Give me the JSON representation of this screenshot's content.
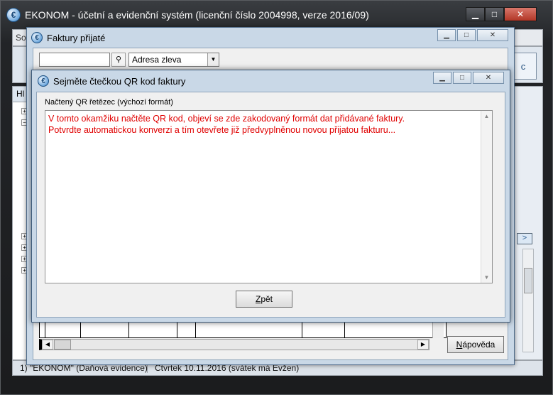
{
  "main_window": {
    "title": "EKONOM - účetní a evidenční systém (licenční číslo 2004998, verze 2016/09)",
    "icon": "ekonom-app-icon",
    "menu_first": "So",
    "tree_header": "Hl",
    "help_glyph": "c",
    "right_button": ">",
    "status": {
      "left": "1) \"EKONOM\" (Daňová evidence)",
      "right": "Čtvrtek 10.11.2016 (svátek má Evžen)"
    }
  },
  "faktury_window": {
    "title": "Faktury přijaté",
    "search_value": "",
    "filter_selected": "Adresa zleva",
    "help_button_prefix": "N",
    "help_button_rest": "ápověda"
  },
  "qr_dialog": {
    "title": "Sejměte čtečkou QR kod faktury",
    "field_label": "Načtený QR řetězec (výchozí formát)",
    "text_lines": [
      "V tomto okamžiku načtěte QR kod, objeví se zde zakodovaný formát dat přidávané faktury.",
      "Potvrdte automatickou konverzi a tím otevřete již předvyplněnou novou přijatou fakturu..."
    ],
    "text_color": "#e00000",
    "back_button_prefix": "Z",
    "back_button_rest": "pět"
  }
}
